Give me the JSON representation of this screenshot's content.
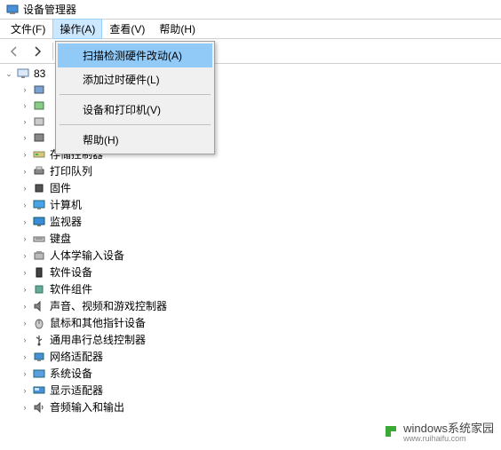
{
  "window": {
    "title": "设备管理器"
  },
  "menu": {
    "file": "文件(F)",
    "action": "操作(A)",
    "view": "查看(V)",
    "help": "帮助(H)"
  },
  "dropdown": {
    "scan": "扫描检测硬件改动(A)",
    "addLegacy": "添加过时硬件(L)",
    "devicesPrinters": "设备和打印机(V)",
    "help": "帮助(H)"
  },
  "tree": {
    "root": "83",
    "nodes": [
      {
        "label": ""
      },
      {
        "label": ""
      },
      {
        "label": ""
      },
      {
        "label": ""
      },
      {
        "label": "存储控制器"
      },
      {
        "label": "打印队列"
      },
      {
        "label": "固件"
      },
      {
        "label": "计算机"
      },
      {
        "label": "监视器"
      },
      {
        "label": "键盘"
      },
      {
        "label": "人体学输入设备"
      },
      {
        "label": "软件设备"
      },
      {
        "label": "软件组件"
      },
      {
        "label": "声音、视频和游戏控制器"
      },
      {
        "label": "鼠标和其他指针设备"
      },
      {
        "label": "通用串行总线控制器"
      },
      {
        "label": "网络适配器"
      },
      {
        "label": "系统设备"
      },
      {
        "label": "显示适配器"
      },
      {
        "label": "音频输入和输出"
      }
    ]
  },
  "watermark": {
    "brand": "windows系统家园",
    "url": "www.ruihaifu.com"
  }
}
